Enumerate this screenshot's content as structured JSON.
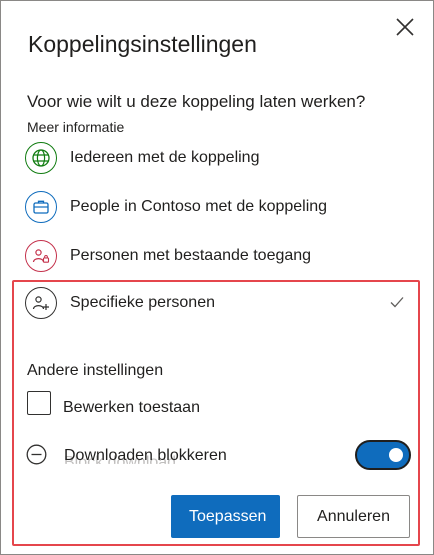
{
  "dialog": {
    "title": "Koppelingsinstellingen",
    "close_icon": "close-icon"
  },
  "question": "Voor wie wilt u deze koppeling laten werken?",
  "learn_more": "Meer informatie",
  "options": [
    {
      "label": "Iedereen met de koppeling",
      "icon": "globe-icon",
      "color": "#107c10",
      "selected": false
    },
    {
      "label": "People in Contoso met de koppeling",
      "icon": "briefcase-icon",
      "color": "#0f6cbd",
      "selected": false
    },
    {
      "label": "Personen met bestaande toegang",
      "icon": "people-lock-icon",
      "color": "#c4314b",
      "selected": false
    },
    {
      "label": "Specifieke personen",
      "icon": "people-add-icon",
      "color": "#323130",
      "selected": true
    }
  ],
  "other_settings": {
    "heading": "Andere instellingen",
    "allow_edit": {
      "label": "Bewerken toestaan",
      "checked": false
    },
    "block_download": {
      "label": "Downloaden blokkeren",
      "overlap_text": "Block download",
      "on": true
    }
  },
  "buttons": {
    "apply": "Toepassen",
    "cancel": "Annuleren"
  },
  "colors": {
    "accent": "#0f6cbd",
    "highlight": "#e5464c"
  }
}
